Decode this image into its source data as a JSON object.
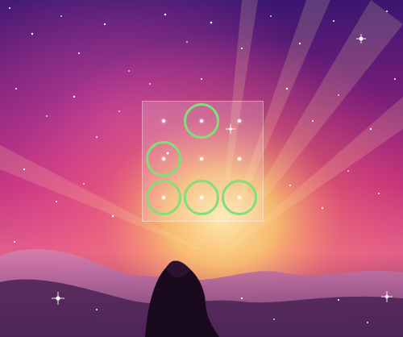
{
  "pattern_lock": {
    "grid_size": 3,
    "nodes": [
      {
        "id": "r1c1",
        "active": false
      },
      {
        "id": "r1c2",
        "active": true
      },
      {
        "id": "r1c3",
        "active": false
      },
      {
        "id": "r2c1",
        "active": true
      },
      {
        "id": "r2c2",
        "active": false
      },
      {
        "id": "r2c3",
        "active": false
      },
      {
        "id": "r3c1",
        "active": true
      },
      {
        "id": "r3c2",
        "active": true
      },
      {
        "id": "r3c3",
        "active": true
      }
    ],
    "active_color": "#7fe07a",
    "dot_color": "#ffffff"
  },
  "wallpaper": {
    "subject": "horsehead-nebula",
    "colors": {
      "top": "#3a1670",
      "mid": "#c0307a",
      "glow": "#ffd36a",
      "silhouette": "#1a0a1e"
    }
  }
}
